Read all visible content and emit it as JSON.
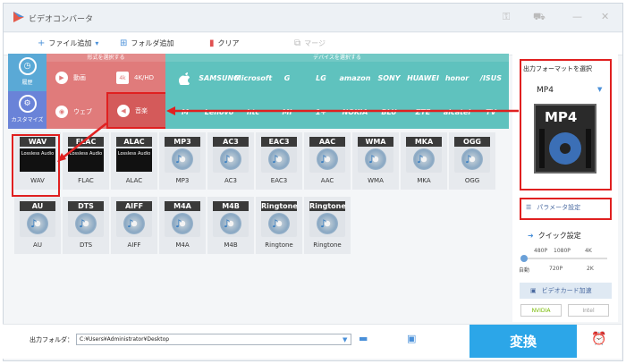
{
  "window": {
    "title": "ビデオコンバータ"
  },
  "toolbar": {
    "add_file": "ファイル追加",
    "add_folder": "フォルダ追加",
    "clear": "クリア",
    "merge": "マージ"
  },
  "categories": {
    "history": "履歴",
    "customize": "カスタマイズ",
    "format_header": "形式を選択する",
    "device_header": "デバイスを選択する"
  },
  "formats": {
    "video": "動画",
    "uhd": "4K/HD",
    "web": "ウェブ",
    "audio": "音楽"
  },
  "devices": {
    "row1": [
      "",
      "SAMSUNG",
      "Microsoft",
      "G",
      "LG",
      "amazon",
      "SONY",
      "HUAWEI",
      "honor",
      "/ISUS"
    ],
    "row2": [
      "M",
      "Lenovo",
      "htc",
      "MI",
      "1+",
      "NOKIA",
      "BLU",
      "ZTE",
      "alcatel",
      "TV"
    ]
  },
  "audio_formats": {
    "row1": [
      "WAV",
      "FLAC",
      "ALAC",
      "MP3",
      "AC3",
      "EAC3",
      "AAC",
      "WMA",
      "MKA",
      "OGG"
    ],
    "row2": [
      "AU",
      "DTS",
      "AIFF",
      "M4A",
      "M4B",
      "Ringtone",
      "Ringtone"
    ]
  },
  "lossless_text": "Lossless Audio",
  "right": {
    "output_label": "出力フォーマットを選択",
    "output_format": "MP4",
    "param": "パラメータ設定",
    "quick": "クイック設定",
    "q_top": [
      "480P",
      "1080P",
      "4K"
    ],
    "q_bottom": [
      "自動",
      "720P",
      "2K"
    ],
    "gpu": "ビデオカード加速",
    "nvidia": "NVIDIA",
    "intel": "Intel"
  },
  "bottom": {
    "output_folder": "出力フォルダ：",
    "path": "C:¥Users¥Administrator¥Desktop",
    "convert": "変換"
  },
  "colors": {
    "format_panel": "#e07b7b",
    "device_panel": "#5fc2be",
    "highlight": "#e02020",
    "convert": "#2ca6e8"
  }
}
